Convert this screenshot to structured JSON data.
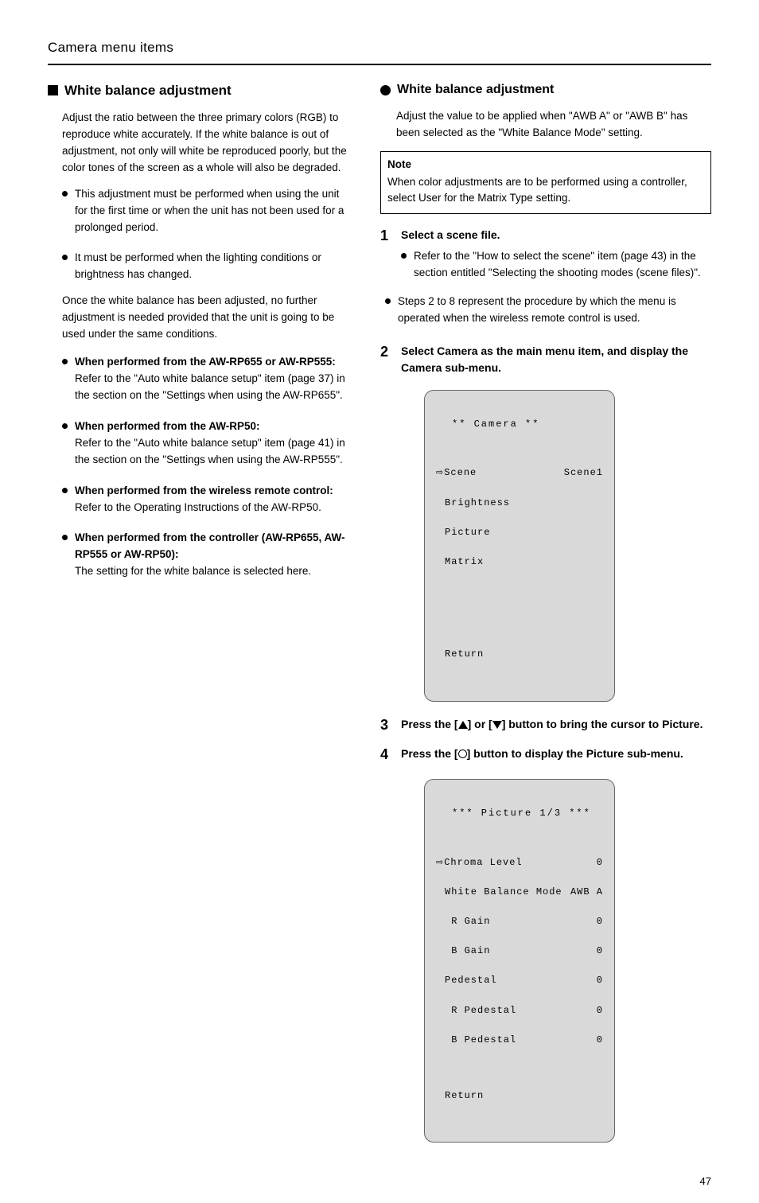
{
  "header": "Camera menu items",
  "page_num": "47",
  "left": {
    "section_title": "White balance adjustment",
    "intro": "Adjust the ratio between the three primary colors (RGB) to reproduce white accurately. If the white balance is out of adjustment, not only will white be reproduced poorly, but the color tones of the screen as a whole will also be degraded.",
    "bullets": [
      "When performed from the AW-RP655 or AW-RP555:",
      "When performed from the AW-RP50:",
      "When performed from the wireless remote control:",
      "When performed from the controller (AW-RP655, AW-RP555 or AW-RP50):"
    ],
    "bullet1_body": "Refer to the \"Auto white balance setup\" item (page 37) in the section on the \"Settings when using the AW-RP655\".",
    "bullet2_body": "Refer to the \"Auto white balance setup\" item (page 41) in the section on the \"Settings when using the AW-RP555\".",
    "bullet3_body": "Refer to the Operating Instructions of the AW-RP50.",
    "bullet4_body": "The setting for the white balance is selected here.",
    "sub_bullets": [
      "This adjustment must be performed when using the unit for the first time or when the unit has not been used for a prolonged period.",
      "It must be performed when the lighting conditions or brightness has changed."
    ],
    "sub_footer": "Once the white balance has been adjusted, no further adjustment is needed provided that the unit is going to be used under the same conditions."
  },
  "right": {
    "subsection_title": "White balance adjustment",
    "sub_desc": "Adjust the value to be applied when \"AWB A\" or \"AWB B\" has been selected as the \"White Balance Mode\" setting.",
    "note_title": "Note",
    "note_body": "When color adjustments are to be performed using a controller, select User for the Matrix Type setting.",
    "steps": [
      {
        "num": "1",
        "text": "Select a scene file.",
        "subs": [
          {
            "text": "Refer to the \"How to select the scene\" item (page 43) in the section entitled \"Selecting the shooting modes (scene files)\"."
          },
          {
            "text": "Steps 2 to 8 represent the procedure by which the menu is operated when the wireless remote control is used."
          }
        ]
      },
      {
        "num": "2",
        "text": "Select Camera as the main menu item, and display the Camera sub-menu.",
        "subs": []
      },
      {
        "num": "3",
        "text_before": "Press the [",
        "text_mid": "] or [",
        "text_after": "] button to bring the cursor to Picture."
      },
      {
        "num": "4",
        "text_before": "Press the [",
        "text_after": "] button to display the Picture sub-menu."
      }
    ],
    "menu1": {
      "title": "** Camera **",
      "rows": [
        {
          "label": "Scene",
          "value": "Scene1",
          "cursor": true
        },
        {
          "label": "Brightness",
          "value": ""
        },
        {
          "label": "Picture",
          "value": ""
        },
        {
          "label": "Matrix",
          "value": ""
        }
      ],
      "return": "Return"
    },
    "menu2": {
      "title": "*** Picture 1/3 ***",
      "rows": [
        {
          "label": "Chroma Level",
          "value": "0",
          "cursor": true
        },
        {
          "label": "White Balance Mode",
          "value": "AWB A"
        },
        {
          "label": " R Gain",
          "value": "0"
        },
        {
          "label": " B Gain",
          "value": "0"
        },
        {
          "label": "Pedestal",
          "value": "0"
        },
        {
          "label": " R Pedestal",
          "value": "0"
        },
        {
          "label": " B Pedestal",
          "value": "0"
        }
      ],
      "return": "Return"
    }
  }
}
